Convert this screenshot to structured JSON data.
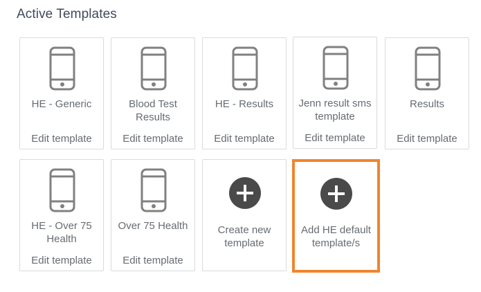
{
  "heading": "Active Templates",
  "templates": [
    {
      "title": "HE - Generic",
      "edit": "Edit template"
    },
    {
      "title": "Blood Test Results",
      "edit": "Edit template"
    },
    {
      "title": "HE - Results",
      "edit": "Edit template"
    },
    {
      "title": "Jenn result sms template",
      "edit": "Edit template"
    },
    {
      "title": "Results",
      "edit": "Edit template"
    },
    {
      "title": "HE - Over 75 Health",
      "edit": "Edit template"
    },
    {
      "title": "Over 75 Health",
      "edit": "Edit template"
    }
  ],
  "actions": {
    "create": "Create new template",
    "add_default": "Add HE default template/s"
  },
  "colors": {
    "highlight": "#f0852e",
    "icon_circle": "#4a4a4a",
    "text": "#666b72",
    "heading": "#3f4a5a"
  },
  "icons": {
    "template": "phone-icon",
    "action": "plus-circle-icon"
  }
}
